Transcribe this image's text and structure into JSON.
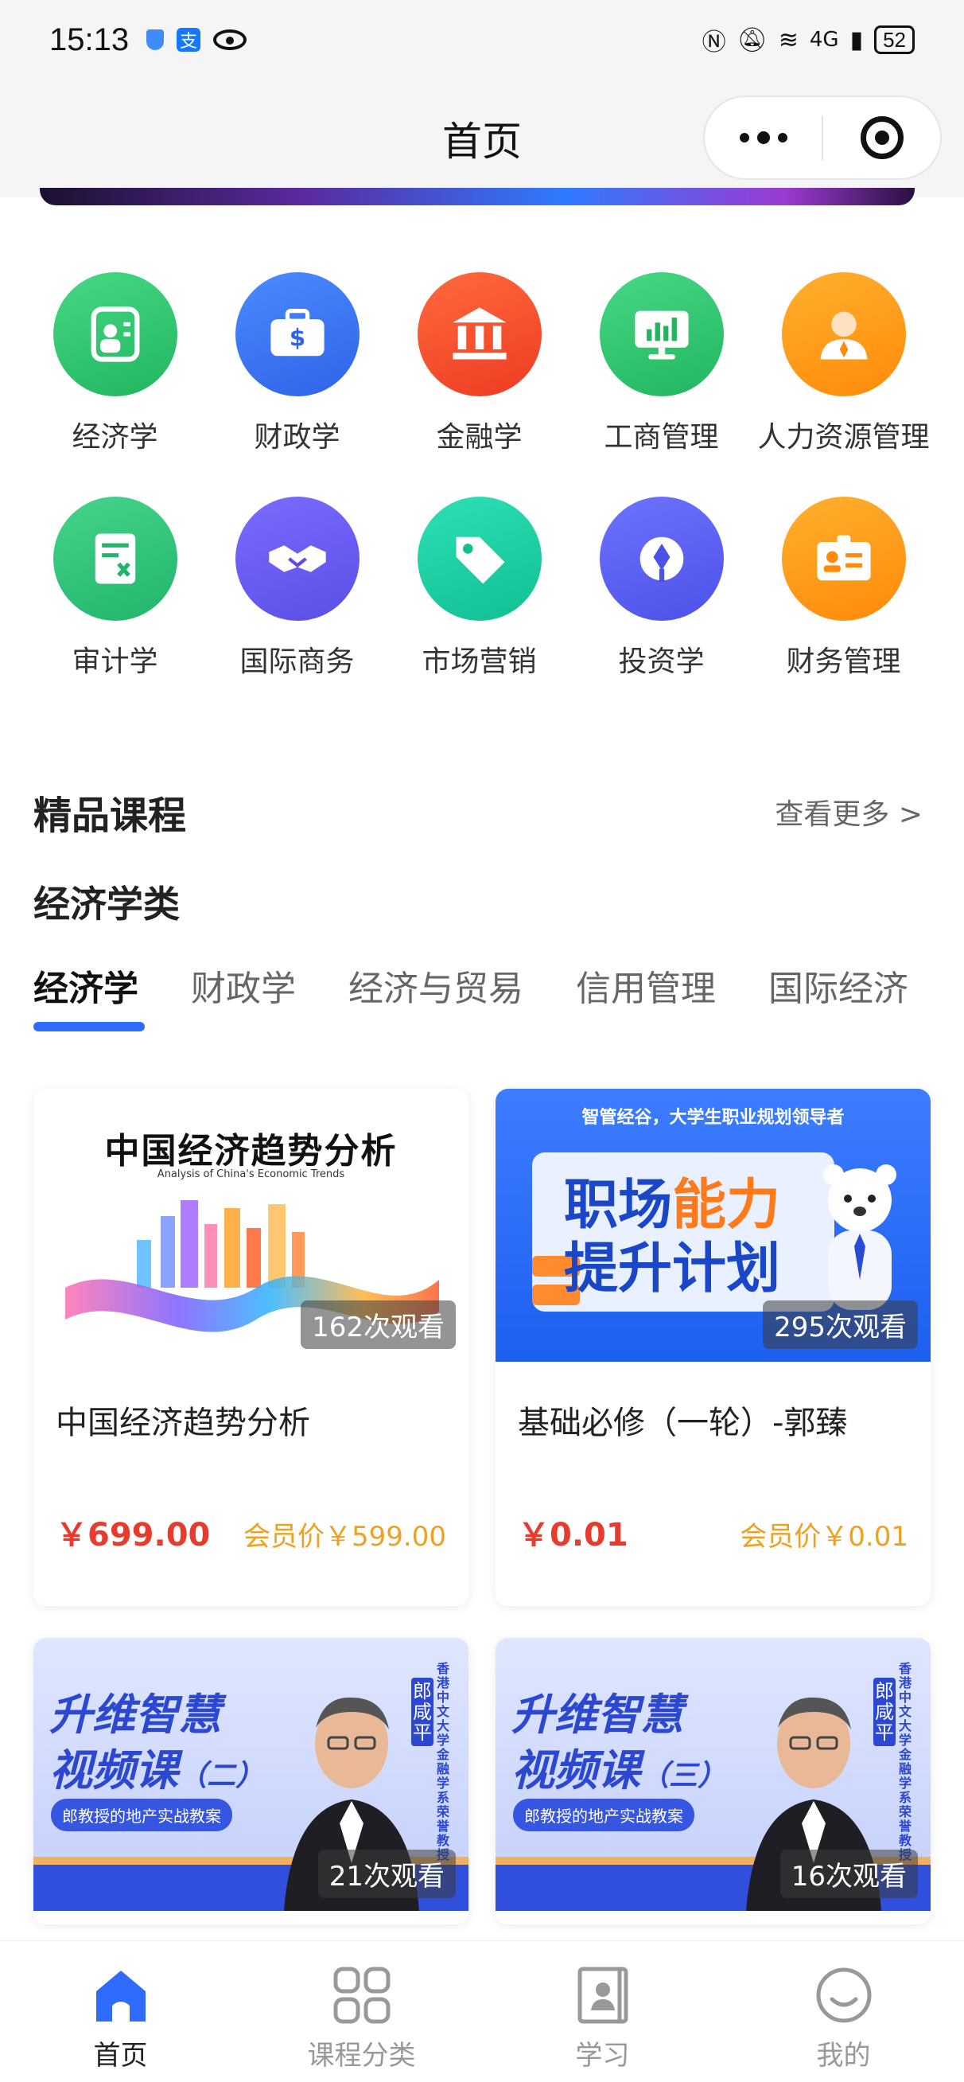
{
  "status_bar": {
    "time": "15:13",
    "battery": "52",
    "network": "4G"
  },
  "nav": {
    "title": "首页"
  },
  "categories": [
    {
      "label": "经济学",
      "icon": "economics-icon",
      "color": "#2fc26b"
    },
    {
      "label": "财政学",
      "icon": "briefcase-dollar-icon",
      "color": "#3a74f5"
    },
    {
      "label": "金融学",
      "icon": "bank-icon",
      "color": "#f2492a"
    },
    {
      "label": "工商管理",
      "icon": "monitor-chart-icon",
      "color": "#2fc26b"
    },
    {
      "label": "人力资源管理",
      "icon": "person-icon",
      "color": "#ff9a12"
    },
    {
      "label": "审计学",
      "icon": "audit-document-icon",
      "color": "#2ec27b"
    },
    {
      "label": "国际商务",
      "icon": "handshake-icon",
      "color": "#6a5ff0"
    },
    {
      "label": "市场营销",
      "icon": "price-tag-icon",
      "color": "#19cfa0"
    },
    {
      "label": "投资学",
      "icon": "investment-icon",
      "color": "#5f63f0"
    },
    {
      "label": "财务管理",
      "icon": "id-card-icon",
      "color": "#ff9a12"
    }
  ],
  "section": {
    "title": "精品课程",
    "more": "查看更多 >",
    "subtitle": "经济学类"
  },
  "tabs": [
    {
      "label": "经济学",
      "active": true
    },
    {
      "label": "财政学",
      "active": false
    },
    {
      "label": "经济与贸易",
      "active": false
    },
    {
      "label": "信用管理",
      "active": false
    },
    {
      "label": "国际经济",
      "active": false
    }
  ],
  "courses": [
    {
      "title": "中国经济趋势分析",
      "views": "162次观看",
      "price": "￥699.00",
      "member_price": "会员价￥599.00",
      "thumb_title": "中国经济趋势分析",
      "thumb_subtitle": "Analysis of China's Economic Trends"
    },
    {
      "title": "基础必修（一轮）-郭臻",
      "views": "295次观看",
      "price": "￥0.01",
      "member_price": "会员价￥0.01",
      "thumb_top": "智管经谷，大学生职业规划领导者",
      "thumb_line1_a": "职场",
      "thumb_line1_b": "能力",
      "thumb_line2": "提升计划"
    },
    {
      "views": "21次观看",
      "thumb_line1": "升维智慧",
      "thumb_line2": "视频课",
      "thumb_num": "（二）",
      "thumb_tag": "郎教授的地产实战教案",
      "thumb_name": "郎咸平",
      "thumb_vertical": "香港中文大学金融学系荣誉教授"
    },
    {
      "views": "16次观看",
      "thumb_line1": "升维智慧",
      "thumb_line2": "视频课",
      "thumb_num": "（三）",
      "thumb_tag": "郎教授的地产实战教案",
      "thumb_name": "郎咸平",
      "thumb_vertical": "香港中文大学金融学系荣誉教授"
    }
  ],
  "tabbar": [
    {
      "label": "首页",
      "active": true
    },
    {
      "label": "课程分类",
      "active": false
    },
    {
      "label": "学习",
      "active": false
    },
    {
      "label": "我的",
      "active": false
    }
  ],
  "colors": {
    "accent": "#2f6bff",
    "price": "#e93a2e",
    "member_price": "#f0a020"
  }
}
